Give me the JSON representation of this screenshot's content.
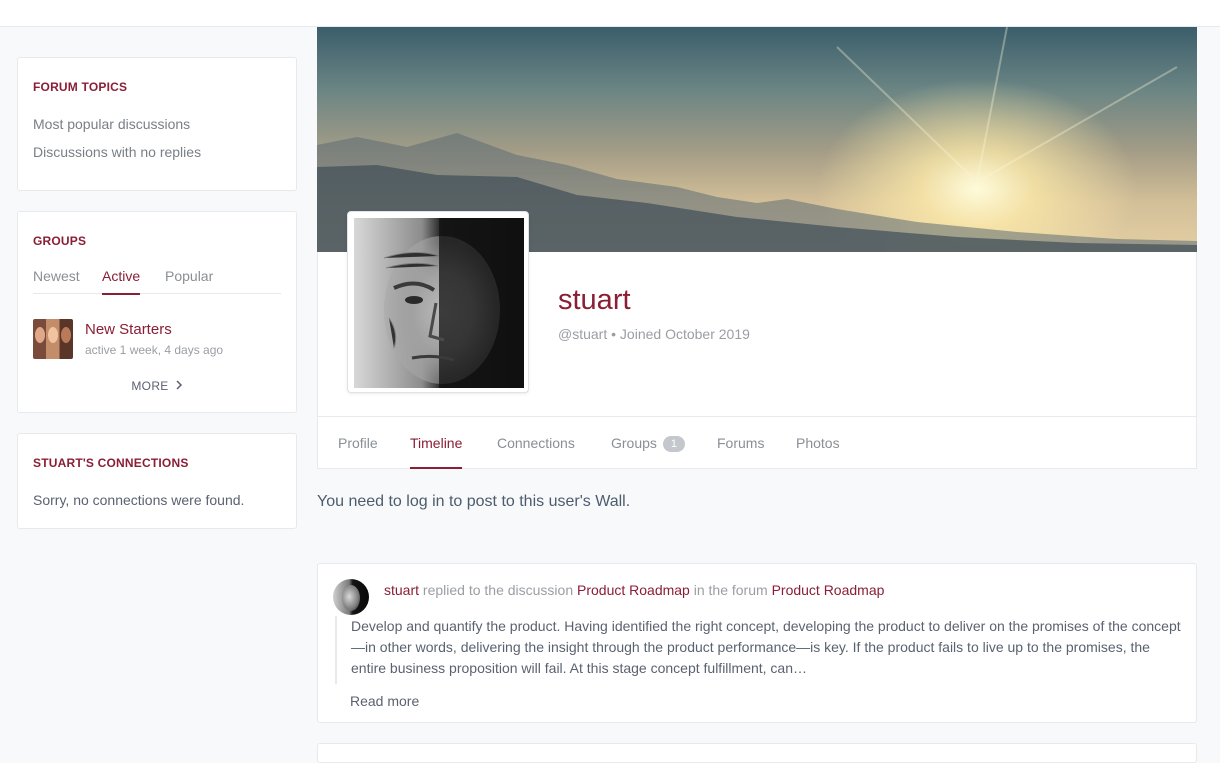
{
  "sidebar": {
    "forum_topics": {
      "title": "FORUM TOPICS",
      "links": [
        "Most popular discussions",
        "Discussions with no replies"
      ]
    },
    "groups": {
      "title": "GROUPS",
      "tabs": [
        "Newest",
        "Active",
        "Popular"
      ],
      "active_tab": "Active",
      "items": [
        {
          "name": "New Starters",
          "meta": "active 1 week, 4 days ago"
        }
      ],
      "more_label": "MORE"
    },
    "connections": {
      "title": "STUART'S CONNECTIONS",
      "message": "Sorry, no connections were found."
    }
  },
  "profile": {
    "name": "stuart",
    "handle": "@stuart",
    "separator": "•",
    "joined": "Joined October 2019",
    "tabs": [
      {
        "label": "Profile"
      },
      {
        "label": "Timeline"
      },
      {
        "label": "Connections"
      },
      {
        "label": "Groups",
        "badge": "1"
      },
      {
        "label": "Forums"
      },
      {
        "label": "Photos"
      }
    ],
    "active_tab": "Timeline"
  },
  "wall_note": "You need to log in to post to this user's Wall.",
  "activity": [
    {
      "user": "stuart",
      "action_1": "replied to the discussion",
      "discussion": "Product Roadmap",
      "action_2": "in the forum",
      "forum": "Product Roadmap",
      "excerpt": "Develop and quantify the product. Having identified the right concept, developing the product to deliver on the promises of the concept—in other words, delivering the insight through the product performance—is key. If the product fails to live up to the promises, the entire business proposition will fail. At this stage concept fulfillment, can…",
      "read_more": "Read more"
    }
  ],
  "colors": {
    "accent": "#8a1e35",
    "muted_text": "#9a9ea3",
    "body_text": "#4d5c6d",
    "border": "#e7e9ec",
    "page_bg": "#f8f9fb"
  },
  "icons": {
    "more_chevron": "chevron-right-icon"
  }
}
